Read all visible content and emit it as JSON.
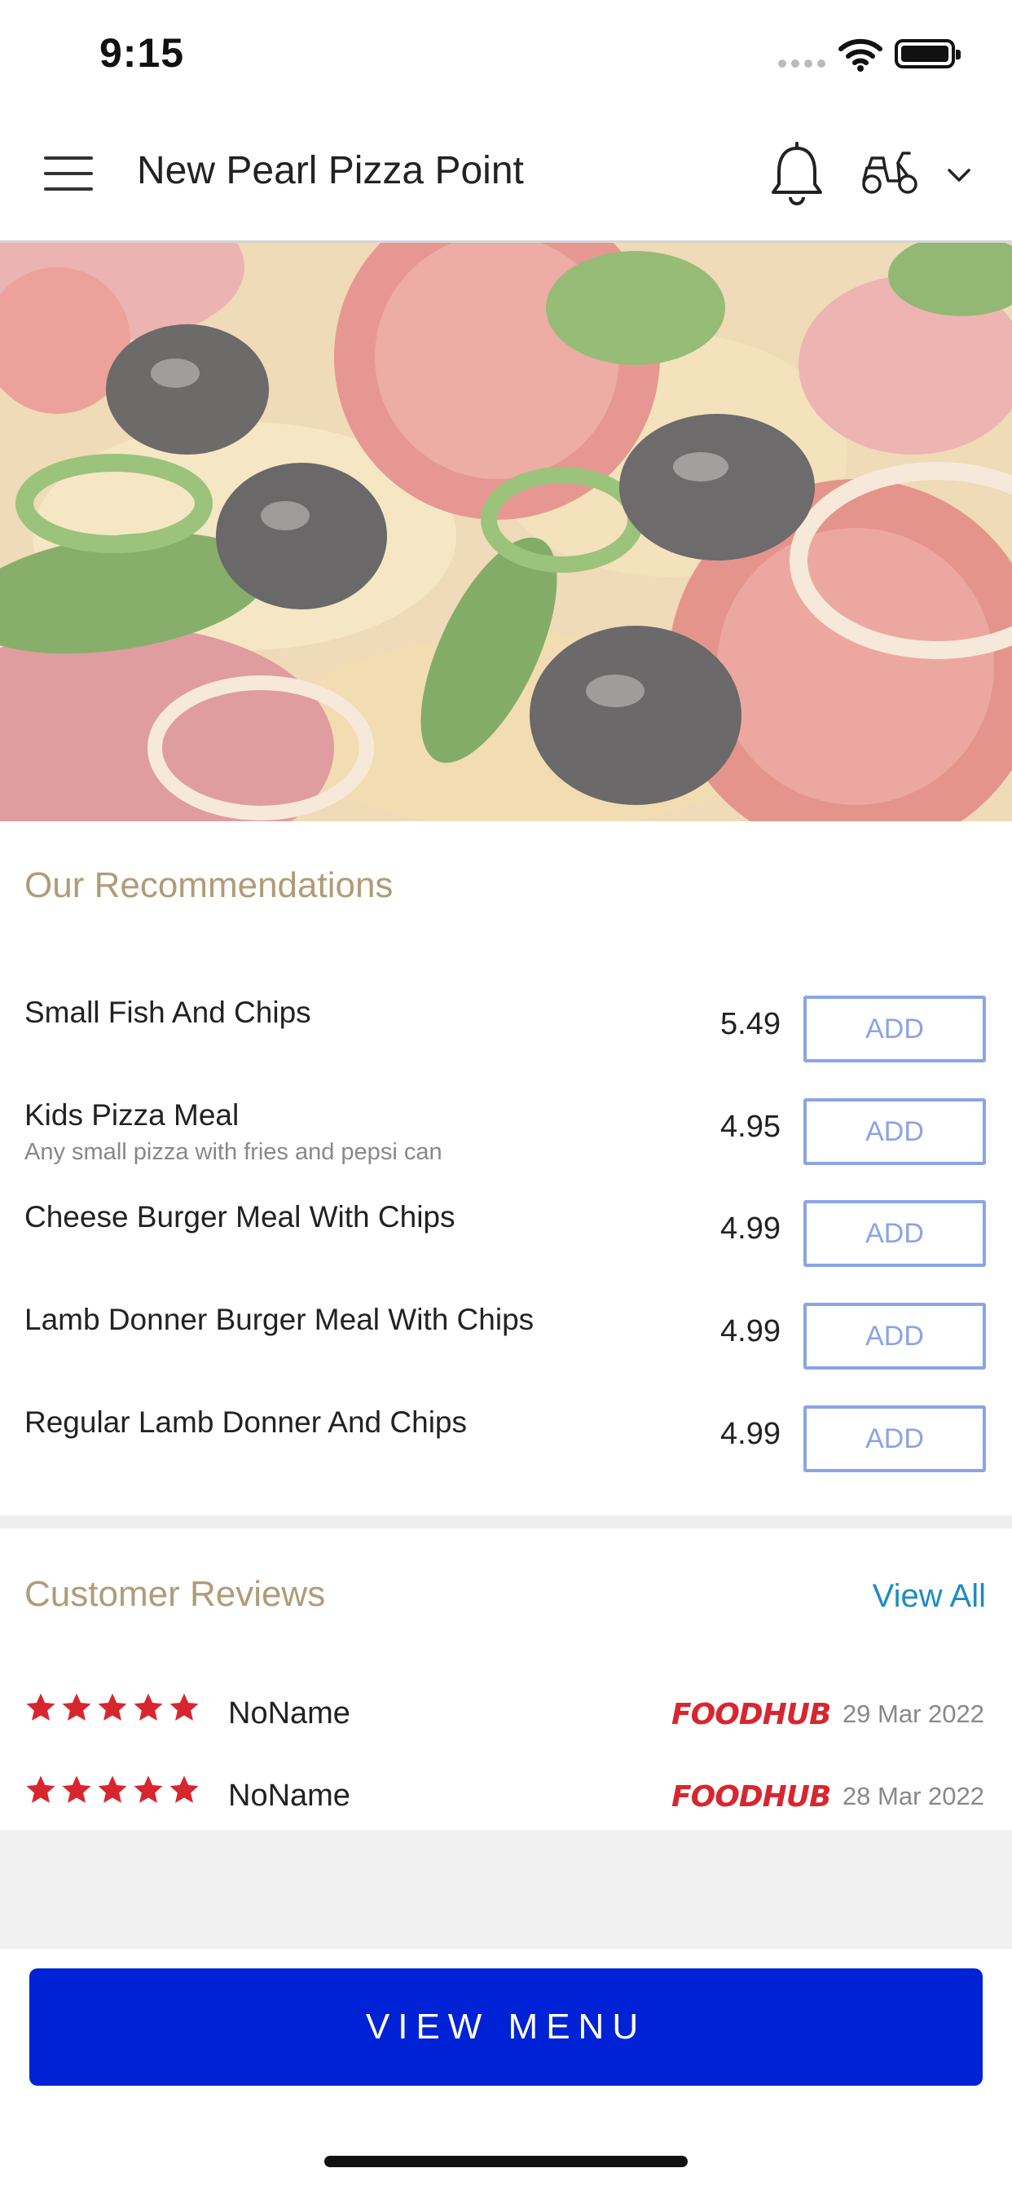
{
  "status_bar": {
    "time": "9:15"
  },
  "header": {
    "title": "New Pearl Pizza Point"
  },
  "recommendations": {
    "title": "Our Recommendations",
    "items": [
      {
        "name": "Small Fish And Chips",
        "description": "",
        "price": "5.49",
        "button": "ADD"
      },
      {
        "name": "Kids Pizza Meal",
        "description": "Any small pizza with fries and pepsi can",
        "price": "4.95",
        "button": "ADD"
      },
      {
        "name": "Cheese Burger Meal With Chips",
        "description": "",
        "price": "4.99",
        "button": "ADD"
      },
      {
        "name": "Lamb Donner Burger Meal With Chips",
        "description": "",
        "price": "4.99",
        "button": "ADD"
      },
      {
        "name": "Regular Lamb Donner And Chips",
        "description": "",
        "price": "4.99",
        "button": "ADD"
      }
    ]
  },
  "reviews": {
    "title": "Customer Reviews",
    "view_all": "View All",
    "items": [
      {
        "rating": 5,
        "name": "NoName",
        "source": "FOODHUB",
        "date": "29 Mar 2022"
      },
      {
        "rating": 5,
        "name": "NoName",
        "source": "FOODHUB",
        "date": "28 Mar 2022"
      }
    ]
  },
  "footer": {
    "view_menu": "VIEW MENU"
  },
  "colors": {
    "accent_title": "#b19b78",
    "add_button": "#8aa4e6",
    "link": "#1f8cc4",
    "primary_button": "#0022d6",
    "star": "#d8262f",
    "foodhub_brand": "#d8262f"
  },
  "icons": [
    "menu-icon",
    "bell-icon",
    "scooter-icon",
    "chevron-down-icon",
    "wifi-icon",
    "battery-icon",
    "star-icon"
  ]
}
